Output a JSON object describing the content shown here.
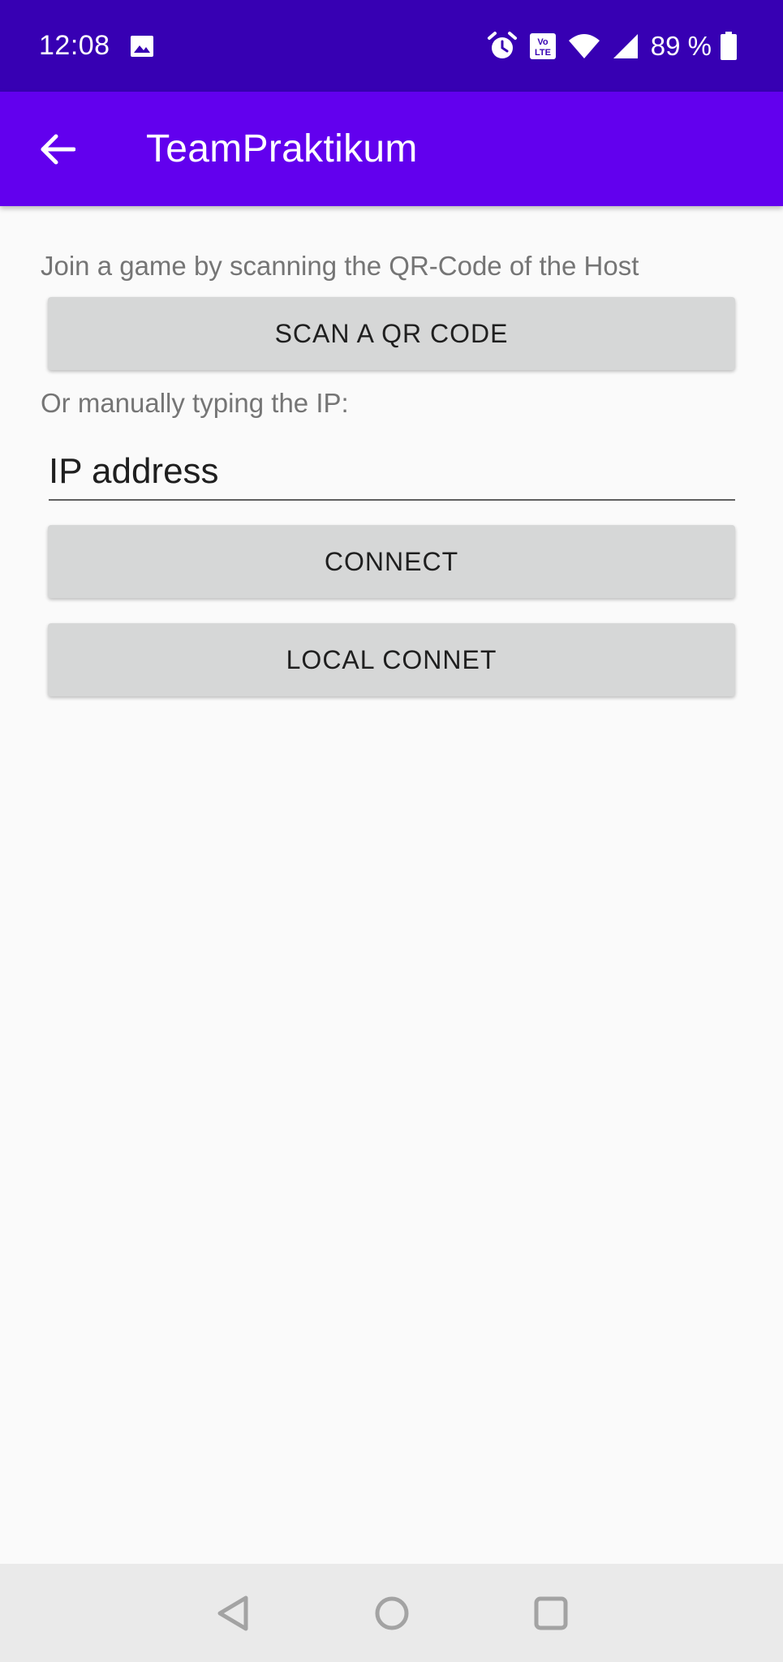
{
  "status_bar": {
    "time": "12:08",
    "battery": "89 %",
    "icons": [
      "image-icon",
      "alarm-icon",
      "volte-icon",
      "wifi-icon",
      "signal-icon",
      "battery-icon"
    ],
    "volte_text": "Vo LTE"
  },
  "app_bar": {
    "title": "TeamPraktikum",
    "back_icon": "back-arrow-icon"
  },
  "main": {
    "join_label": "Join a game by scanning the QR-Code of the Host",
    "scan_button": "SCAN A QR CODE",
    "manual_label": "Or manually typing the IP:",
    "ip_input": {
      "value": "",
      "placeholder": "IP address"
    },
    "connect_button": "CONNECT",
    "local_connect_button": "LOCAL CONNET"
  },
  "nav_bar": {
    "icons": [
      "back-triangle-icon",
      "home-circle-icon",
      "recents-square-icon"
    ]
  },
  "colors": {
    "status_bar": "#3700b3",
    "app_bar": "#6200ee",
    "background": "#fafafa",
    "button": "#d6d7d7",
    "nav_bar": "#eaeaea"
  }
}
